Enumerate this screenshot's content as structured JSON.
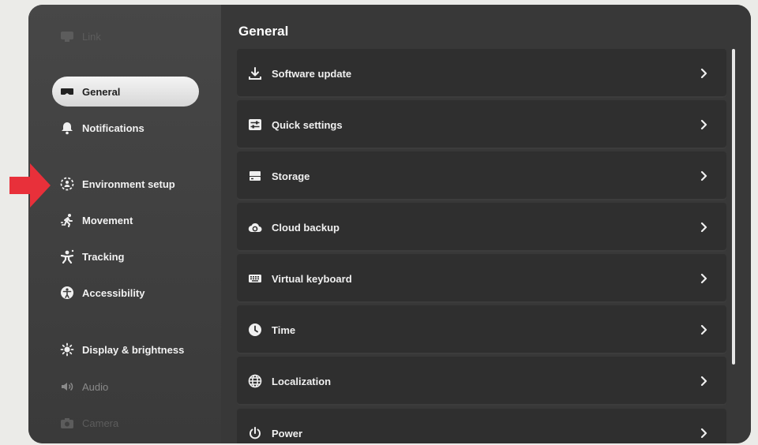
{
  "sidebar": {
    "items": [
      {
        "label": "Link",
        "icon": "link-headset-icon",
        "state": "faded"
      },
      {
        "label": "General",
        "icon": "headset-icon",
        "state": "selected"
      },
      {
        "label": "Notifications",
        "icon": "bell-icon",
        "state": "normal"
      },
      {
        "label": "Environment setup",
        "icon": "environment-icon",
        "state": "normal"
      },
      {
        "label": "Movement",
        "icon": "running-person-icon",
        "state": "normal"
      },
      {
        "label": "Tracking",
        "icon": "tracking-person-icon",
        "state": "normal"
      },
      {
        "label": "Accessibility",
        "icon": "accessibility-icon",
        "state": "normal"
      },
      {
        "label": "Display & brightness",
        "icon": "sun-icon",
        "state": "normal"
      },
      {
        "label": "Audio",
        "icon": "speaker-icon",
        "state": "dim"
      },
      {
        "label": "Camera",
        "icon": "camera-icon",
        "state": "faded"
      }
    ]
  },
  "main": {
    "title": "General",
    "rows": [
      {
        "label": "Software update",
        "icon": "download-icon"
      },
      {
        "label": "Quick settings",
        "icon": "sliders-icon"
      },
      {
        "label": "Storage",
        "icon": "storage-icon"
      },
      {
        "label": "Cloud backup",
        "icon": "cloud-backup-icon"
      },
      {
        "label": "Virtual keyboard",
        "icon": "keyboard-icon"
      },
      {
        "label": "Time",
        "icon": "clock-icon"
      },
      {
        "label": "Localization",
        "icon": "globe-icon"
      },
      {
        "label": "Power",
        "icon": "power-icon"
      }
    ]
  },
  "annotation": {
    "color": "#e8303a",
    "pointing_to": "Environment setup"
  },
  "colors": {
    "selected_bg": "#eaeaea",
    "row_bg": "#2f2f2f",
    "panel_bg": "#383838"
  }
}
